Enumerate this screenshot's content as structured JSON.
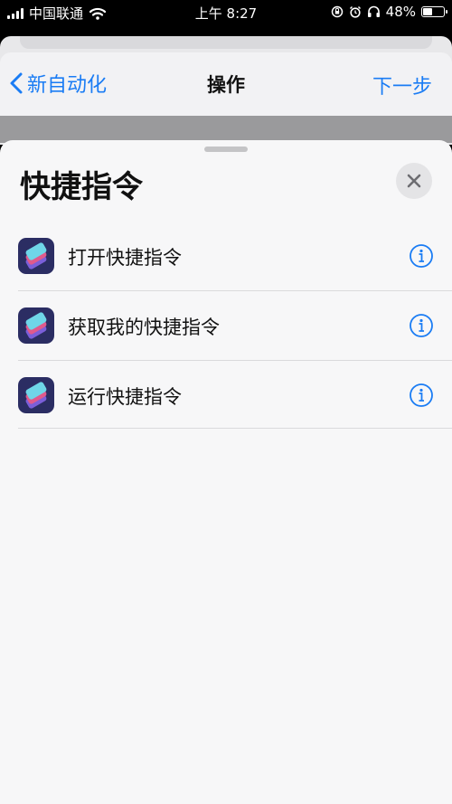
{
  "status_bar": {
    "carrier": "中国联通",
    "time": "上午 8:27",
    "battery": "48%",
    "battery_level": 0.48,
    "icons": [
      "signal-icon",
      "wifi-icon",
      "rotation-lock-icon",
      "alarm-icon",
      "headphones-icon",
      "battery-icon"
    ]
  },
  "navbar": {
    "back_label": "新自动化",
    "title": "操作",
    "next_label": "下一步"
  },
  "sheet": {
    "title": "快捷指令",
    "close_icon": "close-icon",
    "items": [
      {
        "label": "打开快捷指令",
        "icon": "shortcuts-icon",
        "info_icon": "info-icon"
      },
      {
        "label": "获取我的快捷指令",
        "icon": "shortcuts-icon",
        "info_icon": "info-icon"
      },
      {
        "label": "运行快捷指令",
        "icon": "shortcuts-icon",
        "info_icon": "info-icon"
      }
    ]
  },
  "colors": {
    "accent": "#1a7cf4",
    "sheet_background": "#f7f7f8",
    "shortcut_icon_bg": "#2b2d63"
  }
}
